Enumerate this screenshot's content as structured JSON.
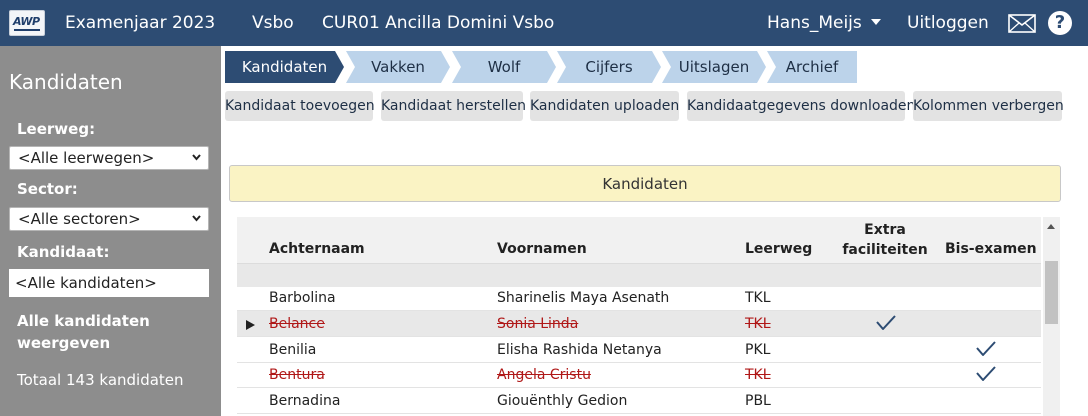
{
  "topbar": {
    "logo_text": "AWP",
    "exam_year": "Examenjaar 2023",
    "department": "Vsbo",
    "school": "CUR01 Ancilla Domini Vsbo",
    "user": "Hans_Meijs",
    "logout": "Uitloggen",
    "mail_icon": "mail-icon",
    "help_icon": "help-icon",
    "help_glyph": "?"
  },
  "sidebar": {
    "title": "Kandidaten",
    "leerweg_label": "Leerweg:",
    "leerweg_value": "<Alle leerwegen>",
    "sector_label": "Sector:",
    "sector_value": "<Alle sectoren>",
    "kandidaat_label": "Kandidaat:",
    "kandidaat_value": "<Alle kandidaten>",
    "show_all_line1": "Alle kandidaten",
    "show_all_line2": "weergeven",
    "total": "Totaal 143 kandidaten"
  },
  "tabs": [
    "Kandidaten",
    "Vakken",
    "Wolf",
    "Cijfers",
    "Uitslagen",
    "Archief"
  ],
  "active_tab": 0,
  "buttons": [
    "Kandidaat toevoegen",
    "Kandidaat herstellen",
    "Kandidaten uploaden",
    "Kandidaatgegevens downloaden",
    "Kolommen verbergen"
  ],
  "banner": "Kandidaten",
  "table": {
    "headers": {
      "achternaam": "Achternaam",
      "voornamen": "Voornamen",
      "leerweg": "Leerweg",
      "extra_line1": "Extra",
      "extra_line2": "faciliteiten",
      "bis": "Bis-examen"
    },
    "rows": [
      {
        "achternaam": "Barbolina",
        "voornamen": "Sharinelis Maya Asenath",
        "leerweg": "TKL",
        "extra": false,
        "bis": false,
        "deleted": false,
        "selected": false
      },
      {
        "achternaam": "Belance",
        "voornamen": "Sonia Linda",
        "leerweg": "TKL",
        "extra": true,
        "bis": false,
        "deleted": true,
        "selected": true
      },
      {
        "achternaam": "Benilia",
        "voornamen": "Elisha Rashida Netanya",
        "leerweg": "PKL",
        "extra": false,
        "bis": true,
        "deleted": false,
        "selected": false
      },
      {
        "achternaam": "Bentura",
        "voornamen": "Angela Cristu",
        "leerweg": "TKL",
        "extra": false,
        "bis": true,
        "deleted": true,
        "selected": false
      },
      {
        "achternaam": "Bernadina",
        "voornamen": "Giouënthly Gedion",
        "leerweg": "PBL",
        "extra": false,
        "bis": false,
        "deleted": false,
        "selected": false
      }
    ]
  },
  "colors": {
    "topbar": "#2d4c73",
    "active_tab": "#2d4c73",
    "tab": "#bcd3ea",
    "sidebar": "#8d8d8d",
    "banner": "#faf3c4",
    "deleted_text": "#b01818",
    "check": "#2d4c73"
  }
}
